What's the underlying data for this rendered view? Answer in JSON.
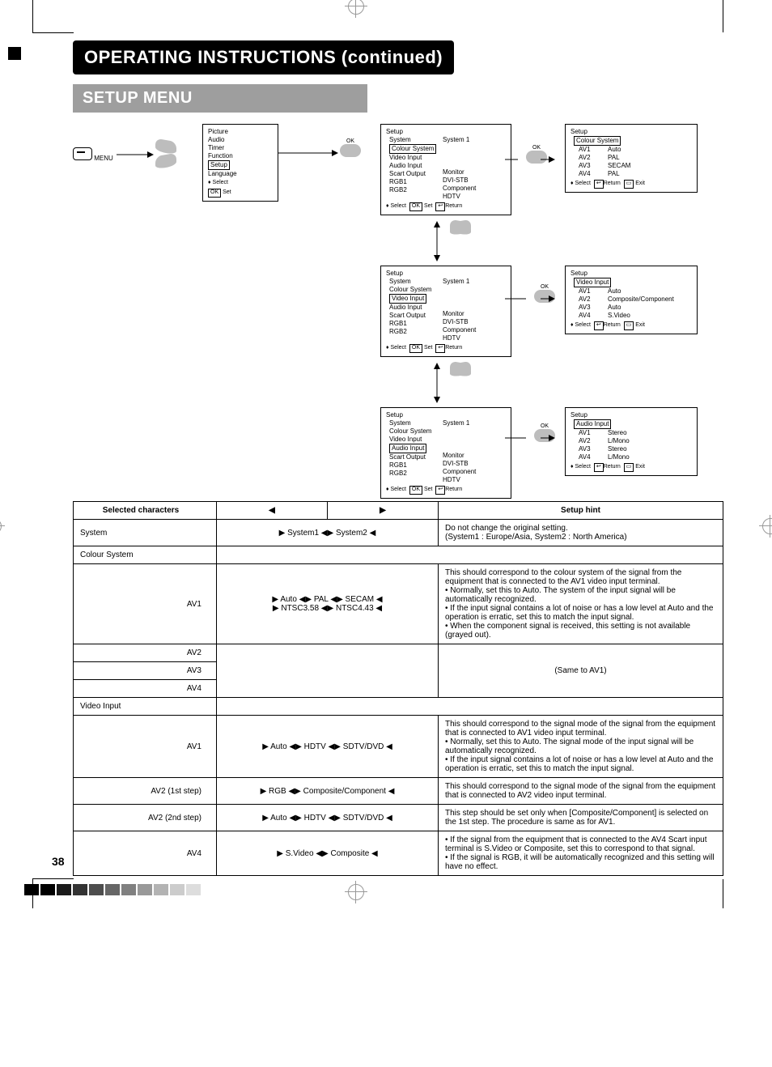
{
  "page_number": "38",
  "title": "OPERATING INSTRUCTIONS (continued)",
  "section": "SETUP MENU",
  "remote": {
    "menu_label": "MENU",
    "ok_label": "OK"
  },
  "main_menu": {
    "items": [
      "Picture",
      "Audio",
      "Timer",
      "Function",
      "Setup",
      "Language"
    ],
    "highlighted": "Setup",
    "footer_select": "Select",
    "footer_set_btn": "OK",
    "footer_set": "Set"
  },
  "setup_panels": [
    {
      "title": "Setup",
      "left": [
        "System",
        "Colour System",
        "Video Input",
        "Audio Input",
        "Scart Output",
        "RGB1",
        "RGB2"
      ],
      "highlighted": "Colour System",
      "right_label": "System 1",
      "right_values": [
        "Monitor",
        "DVI-STB",
        "Component",
        "HDTV"
      ],
      "footer": {
        "select": "Select",
        "set_btn": "OK",
        "set": "Set",
        "return": "Return"
      }
    },
    {
      "title": "Setup",
      "left": [
        "System",
        "Colour System",
        "Video Input",
        "Audio Input",
        "Scart Output",
        "RGB1",
        "RGB2"
      ],
      "highlighted": "Video Input",
      "right_label": "System 1",
      "right_values": [
        "Monitor",
        "DVI-STB",
        "Component",
        "HDTV"
      ],
      "footer": {
        "select": "Select",
        "set_btn": "OK",
        "set": "Set",
        "return": "Return"
      }
    },
    {
      "title": "Setup",
      "left": [
        "System",
        "Colour System",
        "Video Input",
        "Audio Input",
        "Scart Output",
        "RGB1",
        "RGB2"
      ],
      "highlighted": "Audio Input",
      "right_label": "System 1",
      "right_values": [
        "Monitor",
        "DVI-STB",
        "Component",
        "HDTV"
      ],
      "footer": {
        "select": "Select",
        "set_btn": "OK",
        "set": "Set",
        "return": "Return"
      }
    }
  ],
  "detail_panels": [
    {
      "title": "Setup",
      "highlighted": "Colour System",
      "rows": [
        {
          "k": "AV1",
          "v": "Auto"
        },
        {
          "k": "AV2",
          "v": "PAL"
        },
        {
          "k": "AV3",
          "v": "SECAM"
        },
        {
          "k": "AV4",
          "v": "PAL"
        }
      ],
      "footer": {
        "select": "Select",
        "return": "Return",
        "exit": "Exit"
      }
    },
    {
      "title": "Setup",
      "highlighted": "Video Input",
      "rows": [
        {
          "k": "AV1",
          "v": "Auto"
        },
        {
          "k": "AV2",
          "v": "Composite/Component"
        },
        {
          "k": "AV3",
          "v": "Auto"
        },
        {
          "k": "AV4",
          "v": "S.Video"
        }
      ],
      "footer": {
        "select": "Select",
        "return": "Return",
        "exit": "Exit"
      }
    },
    {
      "title": "Setup",
      "highlighted": "Audio Input",
      "rows": [
        {
          "k": "AV1",
          "v": "Stereo"
        },
        {
          "k": "AV2",
          "v": "L/Mono"
        },
        {
          "k": "AV3",
          "v": "Stereo"
        },
        {
          "k": "AV4",
          "v": "L/Mono"
        }
      ],
      "footer": {
        "select": "Select",
        "return": "Return",
        "exit": "Exit"
      }
    }
  ],
  "table": {
    "headers": {
      "char": "Selected characters",
      "hint": "Setup hint"
    },
    "rows": [
      {
        "char": "System",
        "options_lines": [
          "▶ System1 ◀▶ System2 ◀"
        ],
        "hint": "Do not change the original setting.\n(System1 : Europe/Asia, System2 : North America)"
      },
      {
        "char": "Colour System",
        "options_lines": [],
        "hint": "",
        "span_opts_hint": true
      },
      {
        "char": "AV1",
        "options_lines": [
          "▶ Auto ◀▶ PAL ◀▶ SECAM ◀",
          "▶ NTSC3.58 ◀▶ NTSC4.43 ◀"
        ],
        "hint": "This should correspond to the colour system of the signal from the equipment that is connected to the AV1 video input terminal.\n• Normally, set this to Auto. The system of the input signal will be automatically recognized.\n• If the input signal contains a lot of noise or has a low level at Auto and the operation is erratic, set this to match the input signal.\n• When the component signal is received, this setting is not available (grayed out)."
      },
      {
        "char": "AV2",
        "merge_next": true
      },
      {
        "char": "AV3",
        "options_lines": [],
        "hint": "(Same to AV1)",
        "rowspan_note": 3
      },
      {
        "char": "AV4"
      },
      {
        "char": "Video Input",
        "options_lines": [],
        "hint": "",
        "span_opts_hint": true
      },
      {
        "char": "AV1",
        "options_lines": [
          "▶ Auto ◀▶ HDTV ◀▶ SDTV/DVD ◀"
        ],
        "hint": "This should correspond to the signal mode of the signal from the equipment that is connected to AV1 video input terminal.\n• Normally, set this to Auto. The signal mode of the input signal will be automatically recognized.\n• If the input signal contains a lot of noise or has a low level at Auto and the operation is erratic, set this to match the input signal."
      },
      {
        "char": "AV2 (1st step)",
        "options_lines": [
          "▶ RGB ◀▶ Composite/Component ◀"
        ],
        "hint": "This should correspond to the signal mode of the signal from the equipment that is connected to AV2 video input terminal."
      },
      {
        "char": "AV2 (2nd step)",
        "options_lines": [
          "▶ Auto ◀▶ HDTV ◀▶ SDTV/DVD ◀"
        ],
        "hint": "This step should be set only when [Composite/Component] is selected on the 1st step. The procedure is same as for AV1."
      },
      {
        "char": "AV4",
        "options_lines": [
          "▶ S.Video ◀▶ Composite ◀"
        ],
        "hint": "• If the signal from the equipment that is connected to the AV4 Scart input terminal is S.Video or Composite, set this to correspond to that signal.\n• If the signal is RGB, it will be automatically recognized and this setting will have no effect."
      }
    ]
  }
}
